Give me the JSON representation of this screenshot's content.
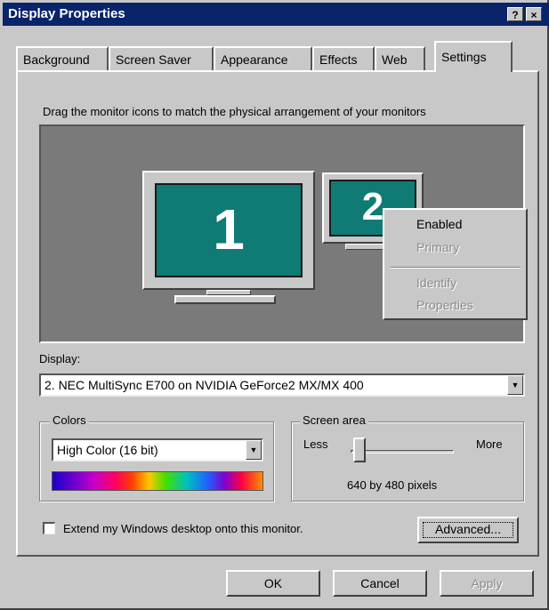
{
  "window": {
    "title": "Display Properties",
    "help_label": "?",
    "close_label": "×"
  },
  "tabs": [
    {
      "label": "Background"
    },
    {
      "label": "Screen Saver"
    },
    {
      "label": "Appearance"
    },
    {
      "label": "Effects"
    },
    {
      "label": "Web"
    },
    {
      "label": "Settings",
      "active": true
    }
  ],
  "settings": {
    "instruction": "Drag the monitor icons to match the physical arrangement of your monitors",
    "monitors": [
      {
        "number": "1"
      },
      {
        "number": "2"
      }
    ],
    "context_menu": {
      "items": [
        {
          "label": "Enabled",
          "enabled": true
        },
        {
          "label": "Primary",
          "enabled": false
        },
        {
          "label": "Identify",
          "enabled": false
        },
        {
          "label": "Properties",
          "enabled": false
        }
      ]
    },
    "display_label": "Display:",
    "display_value": "2. NEC MultiSync E700 on NVIDIA GeForce2 MX/MX 400",
    "colors": {
      "title": "Colors",
      "value": "High Color (16 bit)"
    },
    "screen_area": {
      "title": "Screen area",
      "less_label": "Less",
      "more_label": "More",
      "resolution": "640 by 480 pixels",
      "level": 0
    },
    "extend_label": "Extend my Windows desktop onto this monitor.",
    "extend_checked": false,
    "advanced_label": "Advanced..."
  },
  "buttons": {
    "ok": "OK",
    "cancel": "Cancel",
    "apply": "Apply"
  },
  "colors": {
    "title_bar": "#0a246a",
    "face": "#c8c8c8",
    "monitor_screen": "#0f7b74",
    "desktop_bg": "#7a7a7a"
  }
}
